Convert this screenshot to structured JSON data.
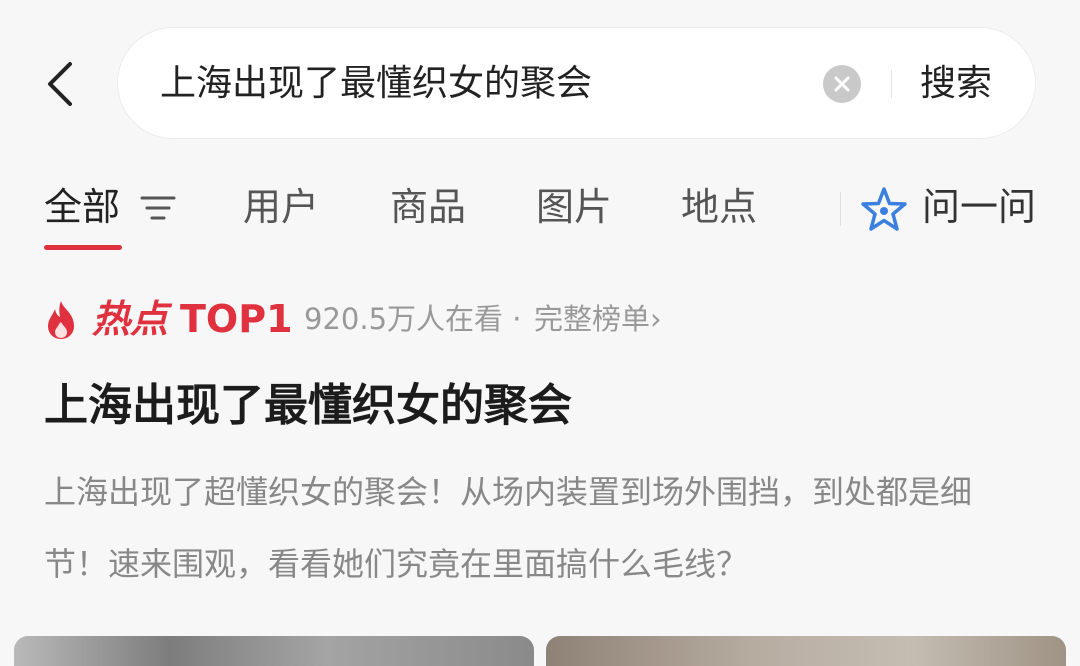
{
  "header": {
    "search_query": "上海出现了最懂织女的聚会",
    "search_button": "搜索"
  },
  "tabs": [
    {
      "label": "全部",
      "active": true
    },
    {
      "label": "用户"
    },
    {
      "label": "商品"
    },
    {
      "label": "图片"
    },
    {
      "label": "地点"
    }
  ],
  "ask": {
    "label": "问一问"
  },
  "hot": {
    "label": "热点",
    "rank": "TOP1",
    "viewers": "920.5万人在看",
    "separator": "·",
    "full_list": "完整榜单",
    "full_list_chevron": "›"
  },
  "topic": {
    "title": "上海出现了最懂织女的聚会",
    "description": "上海出现了超懂织女的聚会！从场内装置到场外围挡，到处都是细节！速来围观，看看她们究竟在里面搞什么毛线？"
  },
  "colors": {
    "accent": "#e0313f",
    "ask_icon": "#3b7fe0"
  },
  "icons": {
    "back": "chevron-left-icon",
    "clear": "clear-x-icon",
    "filter": "filter-icon",
    "ask": "ai-star-icon",
    "flame": "flame-icon"
  }
}
